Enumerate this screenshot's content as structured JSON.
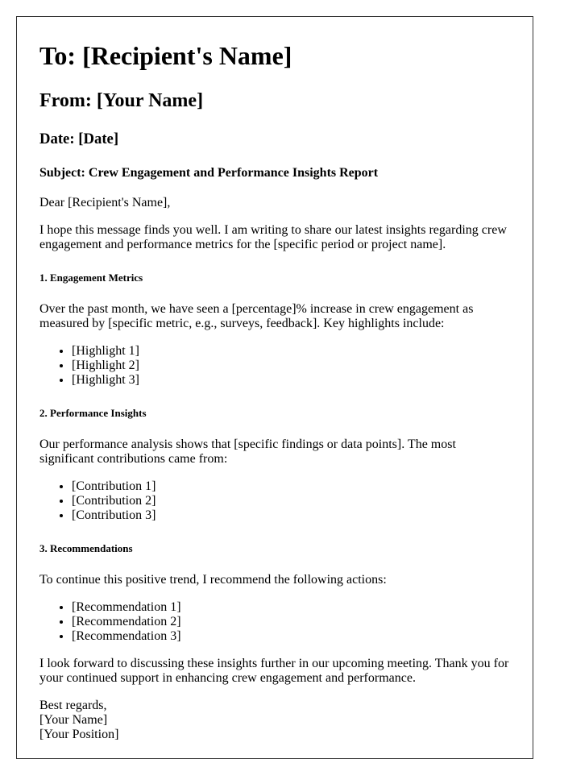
{
  "header": {
    "to": "To: [Recipient's Name]",
    "from": "From: [Your Name]",
    "date": "Date: [Date]",
    "subject": "Subject: Crew Engagement and Performance Insights Report"
  },
  "body": {
    "greeting": "Dear [Recipient's Name],",
    "intro": "I hope this message finds you well. I am writing to share our latest insights regarding crew engagement and performance metrics for the [specific period or project name].",
    "sections": [
      {
        "heading": "1. Engagement Metrics",
        "text": "Over the past month, we have seen a [percentage]% increase in crew engagement as measured by [specific metric, e.g., surveys, feedback]. Key highlights include:",
        "items": [
          "[Highlight 1]",
          "[Highlight 2]",
          "[Highlight 3]"
        ]
      },
      {
        "heading": "2. Performance Insights",
        "text": "Our performance analysis shows that [specific findings or data points]. The most significant contributions came from:",
        "items": [
          "[Contribution 1]",
          "[Contribution 2]",
          "[Contribution 3]"
        ]
      },
      {
        "heading": "3. Recommendations",
        "text": "To continue this positive trend, I recommend the following actions:",
        "items": [
          "[Recommendation 1]",
          "[Recommendation 2]",
          "[Recommendation 3]"
        ]
      }
    ],
    "closing": "I look forward to discussing these insights further in our upcoming meeting. Thank you for your continued support in enhancing crew engagement and performance."
  },
  "signature": {
    "sign_off": "Best regards,",
    "name": "[Your Name]",
    "position": "[Your Position]"
  }
}
